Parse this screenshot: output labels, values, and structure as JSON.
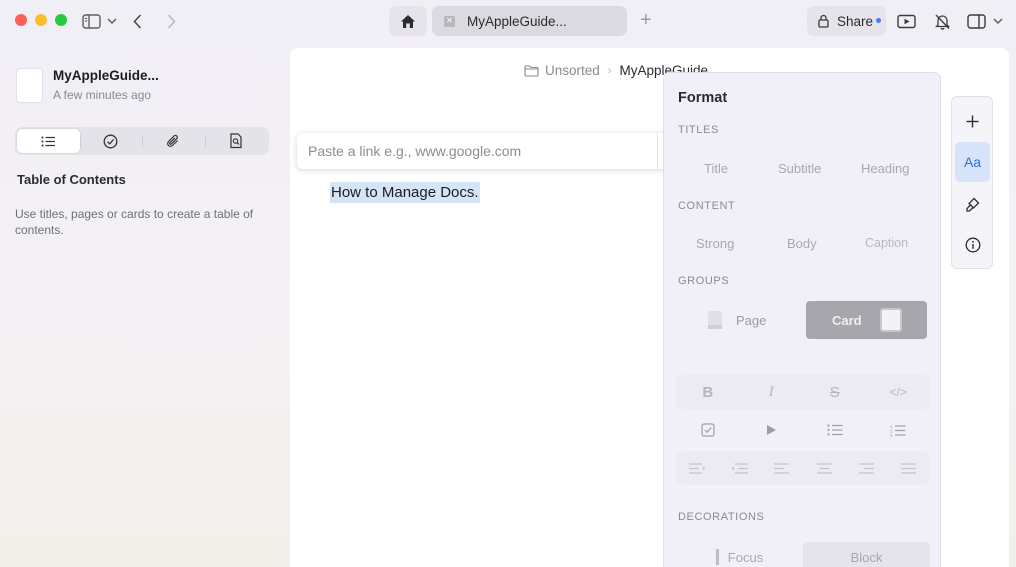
{
  "toolbar": {
    "tab_title": "MyAppleGuide...",
    "new_tab_label": "+",
    "share_label": "Share"
  },
  "sidebar": {
    "doc_title": "MyAppleGuide...",
    "doc_subtitle": "A few minutes ago",
    "segments": [
      "table-of-contents",
      "tasks",
      "attachments",
      "search-document"
    ],
    "active_segment": 0,
    "toc_title": "Table of Contents",
    "toc_description": "Use titles, pages or cards to create a table of contents."
  },
  "editor": {
    "breadcrumb": {
      "folder": "Unsorted",
      "separator": "›",
      "current": "MyAppleGuide..."
    },
    "link_popup": {
      "placeholder": "Paste a link e.g., www.google.com"
    },
    "selected_text": "How to Manage Docs."
  },
  "format_panel": {
    "title": "Format",
    "titles_section": "TITLES",
    "titles": [
      "Title",
      "Subtitle",
      "Heading"
    ],
    "content_section": "CONTENT",
    "content": [
      "Strong",
      "Body",
      "Caption"
    ],
    "groups_section": "GROUPS",
    "group_page": "Page",
    "group_card": "Card",
    "inline_styles": [
      "B",
      "I",
      "S",
      "</>"
    ],
    "decorations_section": "DECORATIONS",
    "decoration_focus": "Focus",
    "decoration_block": "Block"
  },
  "right_toolbar": {
    "format_label": "Aa"
  },
  "colors": {
    "accent_blue": "#2f6fdb",
    "selection": "#d5e4f7",
    "card_active": "#a7a6ad"
  }
}
